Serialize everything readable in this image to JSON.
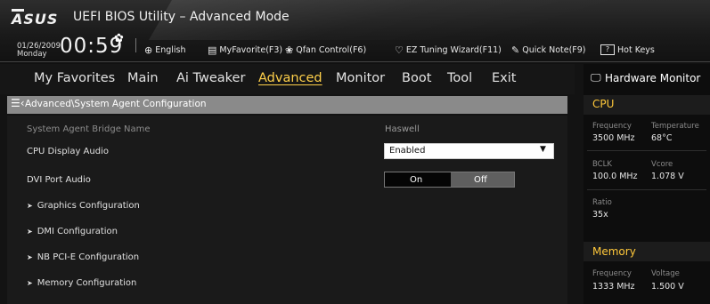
{
  "header": {
    "logo": "ASUS",
    "title": "UEFI BIOS Utility – Advanced Mode",
    "date": "01/26/2009",
    "day": "Monday",
    "time": "00:59",
    "toolbar": {
      "language": "English",
      "myfavorite": "MyFavorite(F3)",
      "qfan": "Qfan Control(F6)",
      "ez_tuning": "EZ Tuning Wizard(F11)",
      "quick_note": "Quick Note(F9)",
      "hot_keys": "Hot Keys",
      "hot_keys_box": "?"
    }
  },
  "nav": {
    "tabs": [
      {
        "label": "My Favorites"
      },
      {
        "label": "Main"
      },
      {
        "label": "Ai Tweaker"
      },
      {
        "label": "Advanced",
        "active": true
      },
      {
        "label": "Monitor"
      },
      {
        "label": "Boot"
      },
      {
        "label": "Tool"
      },
      {
        "label": "Exit"
      }
    ]
  },
  "breadcrumb": "Advanced\\System Agent Configuration",
  "settings": {
    "bridge_name": {
      "label": "System Agent Bridge Name",
      "value": "Haswell"
    },
    "cpu_display_audio": {
      "label": "CPU Display Audio",
      "value": "Enabled"
    },
    "dvi_port_audio": {
      "label": "DVI Port Audio",
      "on": "On",
      "off": "Off",
      "selected": "Off"
    },
    "submenus": [
      {
        "label": "Graphics Configuration"
      },
      {
        "label": "DMI Configuration"
      },
      {
        "label": "NB PCI-E Configuration"
      },
      {
        "label": "Memory Configuration"
      }
    ]
  },
  "hardware_monitor": {
    "title": "Hardware Monitor",
    "cpu": {
      "title": "CPU",
      "frequency_label": "Frequency",
      "frequency": "3500 MHz",
      "temperature_label": "Temperature",
      "temperature": "68°C",
      "bclk_label": "BCLK",
      "bclk": "100.0 MHz",
      "vcore_label": "Vcore",
      "vcore": "1.078 V",
      "ratio_label": "Ratio",
      "ratio": "35x"
    },
    "memory": {
      "title": "Memory",
      "frequency_label": "Frequency",
      "frequency": "1333 MHz",
      "voltage_label": "Voltage",
      "voltage": "1.500 V"
    }
  },
  "colors": {
    "accent": "#ffd04a",
    "section_title": "#ffc83a",
    "breadcrumb_bar": "#8a8a8a",
    "background": "#131313"
  }
}
